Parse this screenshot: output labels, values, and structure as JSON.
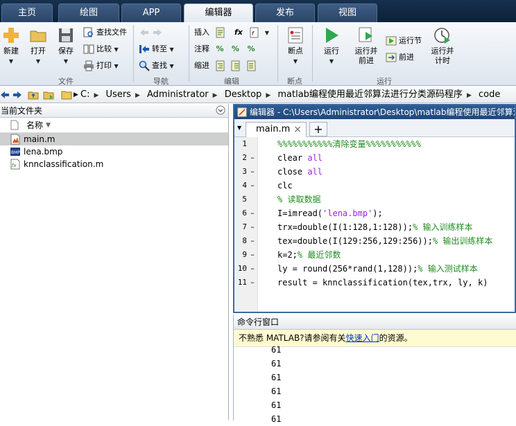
{
  "tabs": [
    "主页",
    "绘图",
    "APP",
    "编辑器",
    "发布",
    "视图"
  ],
  "active_tab_index": 3,
  "ribbon": {
    "file": {
      "new_label": "新建",
      "open_label": "打开",
      "save_label": "保存",
      "find_files_label": "查找文件",
      "compare_label": "比较",
      "print_label": "打印",
      "group_label": "文件"
    },
    "navigate": {
      "goto_label": "转至",
      "find_label": "查找",
      "group_label": "导航"
    },
    "edit": {
      "insert_label": "插入",
      "fx_label": "fx",
      "comment_label": "注释",
      "indent_label": "缩进",
      "group_label": "编辑"
    },
    "breakpoints": {
      "breakpoints_label": "断点",
      "group_label": "断点"
    },
    "run": {
      "run_label": "运行",
      "run_advance_label": "运行并前进",
      "run_section_label": "运行节",
      "advance_label": "前进",
      "run_time_label": "运行并计时",
      "group_label": "运行"
    }
  },
  "address": {
    "crumbs": [
      "C:",
      "Users",
      "Administrator",
      "Desktop",
      "matlab编程使用最近邻算法进行分类源码程序",
      "code"
    ]
  },
  "current_folder": {
    "title": "当前文件夹",
    "column_name": "名称",
    "files": [
      {
        "name": "main.m",
        "icon": "matlab-script-icon",
        "selected": true
      },
      {
        "name": "lena.bmp",
        "icon": "bmp-image-icon",
        "selected": false
      },
      {
        "name": "knnclassification.m",
        "icon": "matlab-function-icon",
        "selected": false
      }
    ]
  },
  "editor": {
    "title": "编辑器 - C:\\Users\\Administrator\\Desktop\\matlab编程使用最近邻算法进行分类源码程序\\code\\main.m",
    "tab_label": "main.m",
    "close_symbol": "×",
    "plus_symbol": "+",
    "lines": [
      {
        "num": "1",
        "dash": "",
        "segments": [
          {
            "t": "%%%%%%%%%%%清除变量%%%%%%%%%%%",
            "c": "cm"
          }
        ]
      },
      {
        "num": "2",
        "dash": "–",
        "segments": [
          {
            "t": "clear ",
            "c": ""
          },
          {
            "t": "all",
            "c": "kw"
          }
        ]
      },
      {
        "num": "3",
        "dash": "–",
        "segments": [
          {
            "t": "close ",
            "c": ""
          },
          {
            "t": "all",
            "c": "kw"
          }
        ]
      },
      {
        "num": "4",
        "dash": "–",
        "segments": [
          {
            "t": "clc",
            "c": ""
          }
        ]
      },
      {
        "num": "5",
        "dash": "",
        "segments": [
          {
            "t": "% 读取数据",
            "c": "cm"
          }
        ]
      },
      {
        "num": "6",
        "dash": "–",
        "segments": [
          {
            "t": "I=imread(",
            "c": ""
          },
          {
            "t": "'lena.bmp'",
            "c": "st"
          },
          {
            "t": ");",
            "c": ""
          }
        ]
      },
      {
        "num": "7",
        "dash": "–",
        "segments": [
          {
            "t": "trx=double(I(1:128,1:128));",
            "c": ""
          },
          {
            "t": "% 输入训练样本",
            "c": "cm"
          }
        ]
      },
      {
        "num": "8",
        "dash": "–",
        "segments": [
          {
            "t": "tex=double(I(129:256,129:256));",
            "c": ""
          },
          {
            "t": "% 输出训练样本",
            "c": "cm"
          }
        ]
      },
      {
        "num": "9",
        "dash": "–",
        "segments": [
          {
            "t": "k=2;",
            "c": ""
          },
          {
            "t": "% 最近邻数",
            "c": "cm"
          }
        ]
      },
      {
        "num": "10",
        "dash": "–",
        "segments": [
          {
            "t": "ly = round(256*rand(1,128));",
            "c": ""
          },
          {
            "t": "% 输入测试样本",
            "c": "cm"
          }
        ]
      },
      {
        "num": "11",
        "dash": "–",
        "segments": [
          {
            "t": "result = knnclassification(tex,trx, ly, k)",
            "c": ""
          }
        ]
      }
    ]
  },
  "command_window": {
    "title": "命令行窗口",
    "notice_prefix": "不熟悉 MATLAB?请参阅有关",
    "notice_link": "快速入门",
    "notice_suffix": "的资源。",
    "output": [
      "61",
      "61",
      "61",
      "61",
      "61",
      "61"
    ]
  }
}
